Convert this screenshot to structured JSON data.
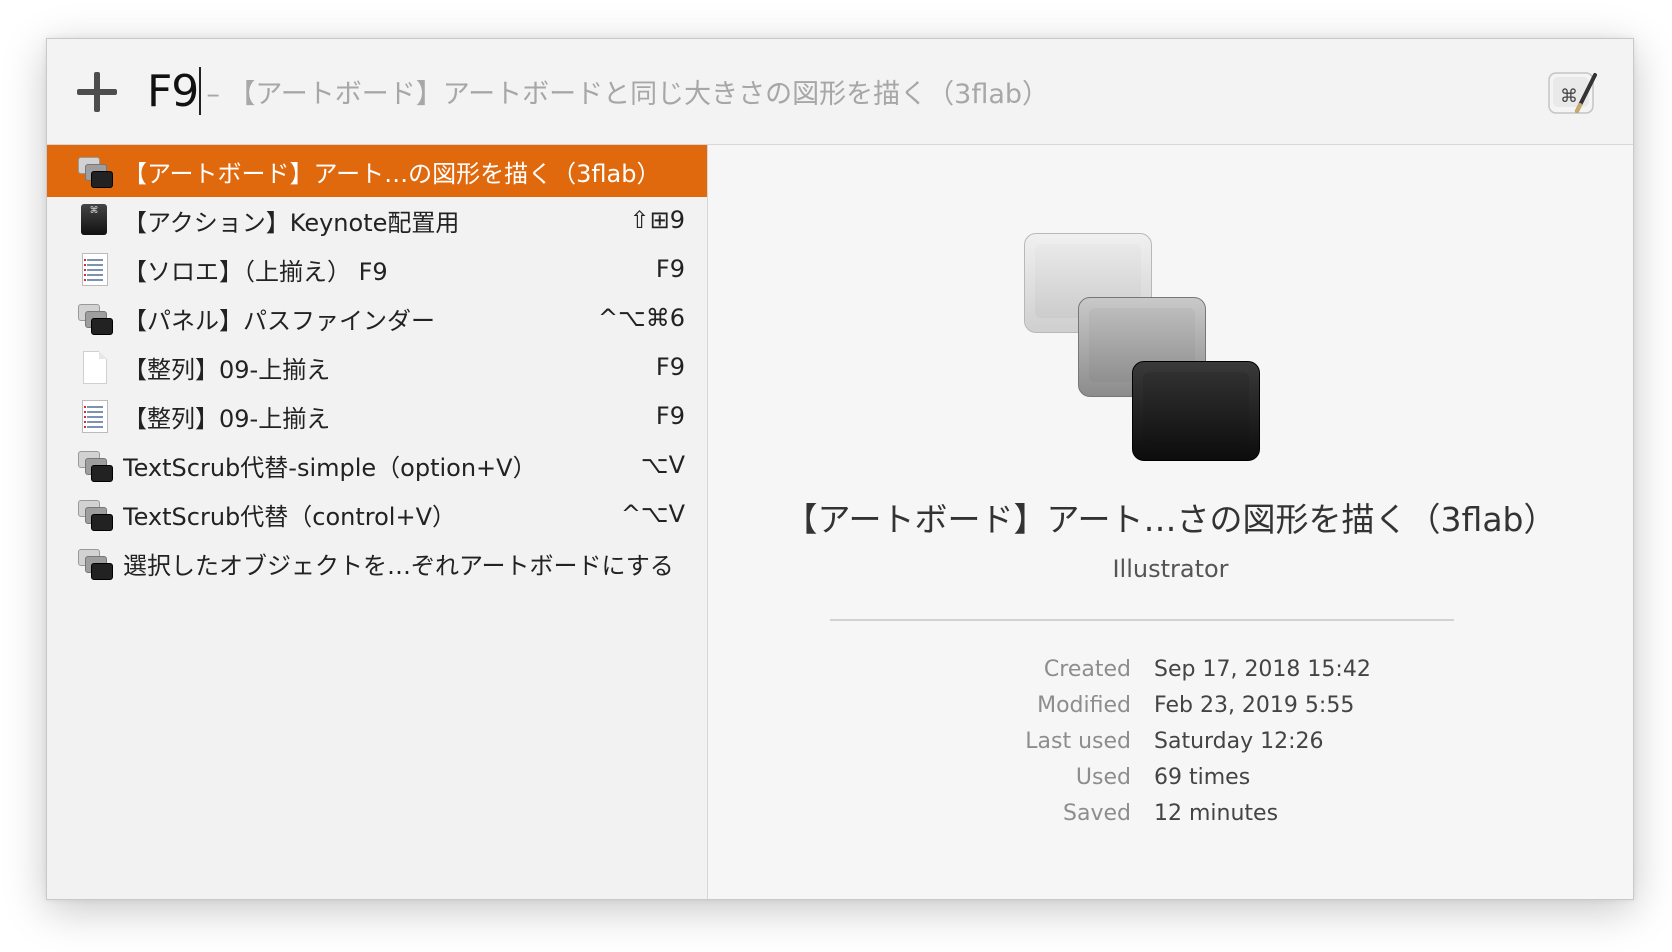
{
  "search": {
    "query": "F9",
    "completion": "– 【アートボード】アートボードと同じ大きさの図形を描く（3flab）"
  },
  "results": [
    {
      "title": "【アートボード】アート…の図形を描く（3flab）",
      "shortcut": "",
      "icon": "stacked-keys-icon",
      "selected": true
    },
    {
      "title": "【アクション】Keynote配置用",
      "shortcut": "⇧⊞9",
      "icon": "action-key-icon",
      "selected": false
    },
    {
      "title": "【ソロエ】（上揃え） F9",
      "shortcut": "F9",
      "icon": "list-document-icon",
      "selected": false
    },
    {
      "title": "【パネル】パスファインダー",
      "shortcut": "^⌥⌘6",
      "icon": "stacked-keys-icon",
      "selected": false
    },
    {
      "title": "【整列】09-上揃え",
      "shortcut": "F9",
      "icon": "blank-document-icon",
      "selected": false
    },
    {
      "title": "【整列】09-上揃え",
      "shortcut": "F9",
      "icon": "list-document-icon",
      "selected": false
    },
    {
      "title": "TextScrub代替-simple（option+V）",
      "shortcut": "⌥V",
      "icon": "stacked-keys-icon",
      "selected": false
    },
    {
      "title": "TextScrub代替（control+V）",
      "shortcut": "^⌥V",
      "icon": "stacked-keys-icon",
      "selected": false
    },
    {
      "title": "選択したオブジェクトを…ぞれアートボードにする",
      "shortcut": "",
      "icon": "stacked-keys-icon",
      "selected": false
    }
  ],
  "detail": {
    "title": "【アートボード】アート…さの図形を描く（3flab）",
    "subtitle": "Illustrator",
    "meta": [
      {
        "label": "Created",
        "value": "Sep 17, 2018 15:42"
      },
      {
        "label": "Modified",
        "value": "Feb 23, 2019 5:55"
      },
      {
        "label": "Last used",
        "value": "Saturday 12:26"
      },
      {
        "label": "Used",
        "value": "69 times"
      },
      {
        "label": "Saved",
        "value": "12 minutes"
      }
    ]
  },
  "colors": {
    "selection": "#e0690d",
    "list_background": "#f2f2f2",
    "detail_background": "#f6f6f6"
  }
}
